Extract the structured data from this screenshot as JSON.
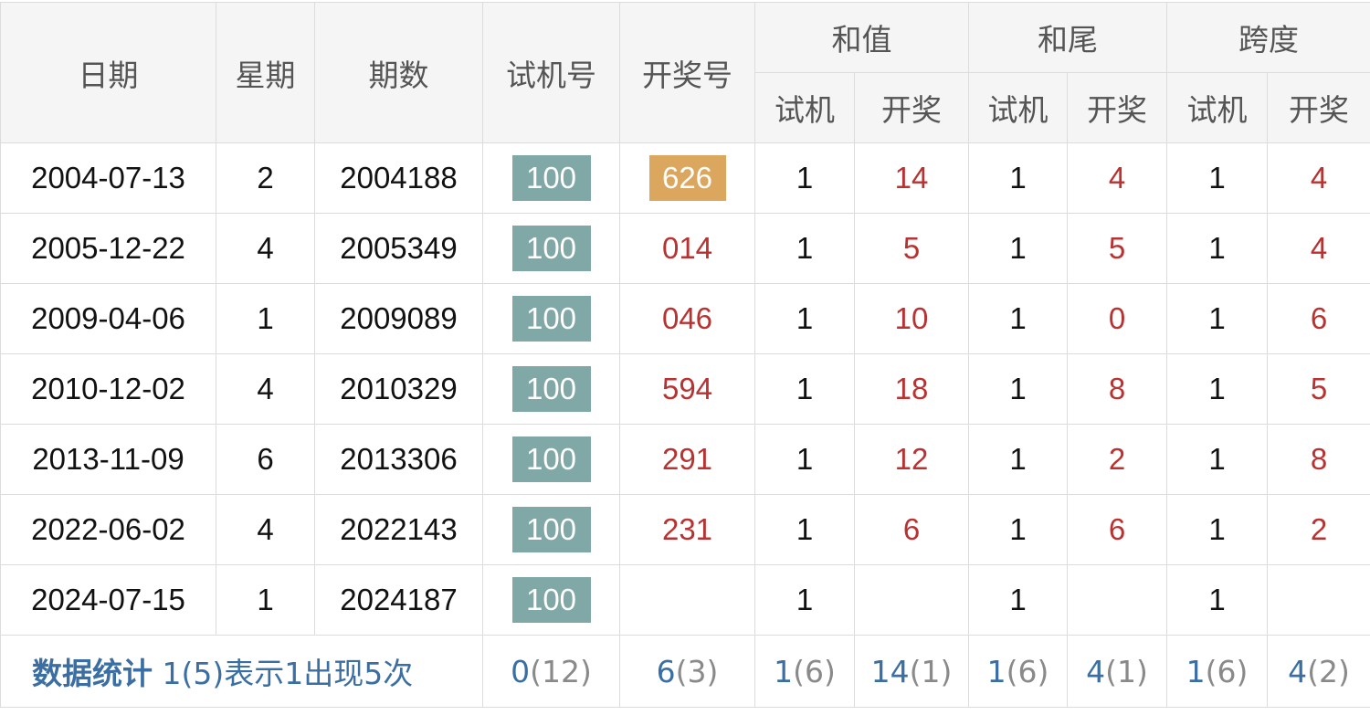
{
  "header": {
    "date": "日期",
    "weekday": "星期",
    "period": "期数",
    "test_number": "试机号",
    "draw_number": "开奖号",
    "sum_group": "和值",
    "tail_group": "和尾",
    "span_group": "跨度",
    "sub_test": "试机",
    "sub_draw": "开奖"
  },
  "rows": [
    {
      "date": "2004-07-13",
      "weekday": "2",
      "period": "2004188",
      "test": "100",
      "draw": "626",
      "draw_highlight": true,
      "sum_test": "1",
      "sum_draw": "14",
      "tail_test": "1",
      "tail_draw": "4",
      "span_test": "1",
      "span_draw": "4"
    },
    {
      "date": "2005-12-22",
      "weekday": "4",
      "period": "2005349",
      "test": "100",
      "draw": "014",
      "draw_highlight": false,
      "sum_test": "1",
      "sum_draw": "5",
      "tail_test": "1",
      "tail_draw": "5",
      "span_test": "1",
      "span_draw": "4"
    },
    {
      "date": "2009-04-06",
      "weekday": "1",
      "period": "2009089",
      "test": "100",
      "draw": "046",
      "draw_highlight": false,
      "sum_test": "1",
      "sum_draw": "10",
      "tail_test": "1",
      "tail_draw": "0",
      "span_test": "1",
      "span_draw": "6"
    },
    {
      "date": "2010-12-02",
      "weekday": "4",
      "period": "2010329",
      "test": "100",
      "draw": "594",
      "draw_highlight": false,
      "sum_test": "1",
      "sum_draw": "18",
      "tail_test": "1",
      "tail_draw": "8",
      "span_test": "1",
      "span_draw": "5"
    },
    {
      "date": "2013-11-09",
      "weekday": "6",
      "period": "2013306",
      "test": "100",
      "draw": "291",
      "draw_highlight": false,
      "sum_test": "1",
      "sum_draw": "12",
      "tail_test": "1",
      "tail_draw": "2",
      "span_test": "1",
      "span_draw": "8"
    },
    {
      "date": "2022-06-02",
      "weekday": "4",
      "period": "2022143",
      "test": "100",
      "draw": "231",
      "draw_highlight": false,
      "sum_test": "1",
      "sum_draw": "6",
      "tail_test": "1",
      "tail_draw": "6",
      "span_test": "1",
      "span_draw": "2"
    },
    {
      "date": "2024-07-15",
      "weekday": "1",
      "period": "2024187",
      "test": "100",
      "draw": "",
      "draw_highlight": false,
      "sum_test": "1",
      "sum_draw": "",
      "tail_test": "1",
      "tail_draw": "",
      "span_test": "1",
      "span_draw": ""
    }
  ],
  "stats": {
    "label": "数据统计",
    "note": "1(5)表示1出现5次",
    "test": {
      "value": "0",
      "count": "(12)"
    },
    "draw": {
      "value": "6",
      "count": "(3)"
    },
    "sum_test": {
      "value": "1",
      "count": "(6)"
    },
    "sum_draw": {
      "value": "14",
      "count": "(1)"
    },
    "tail_test": {
      "value": "1",
      "count": "(6)"
    },
    "tail_draw": {
      "value": "4",
      "count": "(1)"
    },
    "span_test": {
      "value": "1",
      "count": "(6)"
    },
    "span_draw": {
      "value": "4",
      "count": "(2)"
    }
  },
  "colors": {
    "header_bg": "#f5f5f5",
    "border": "#dcdcdc",
    "test_badge": "#7fa8a6",
    "draw_badge": "#dba75f",
    "draw_red": "#b83232",
    "stats_blue": "#3b6fa3"
  }
}
